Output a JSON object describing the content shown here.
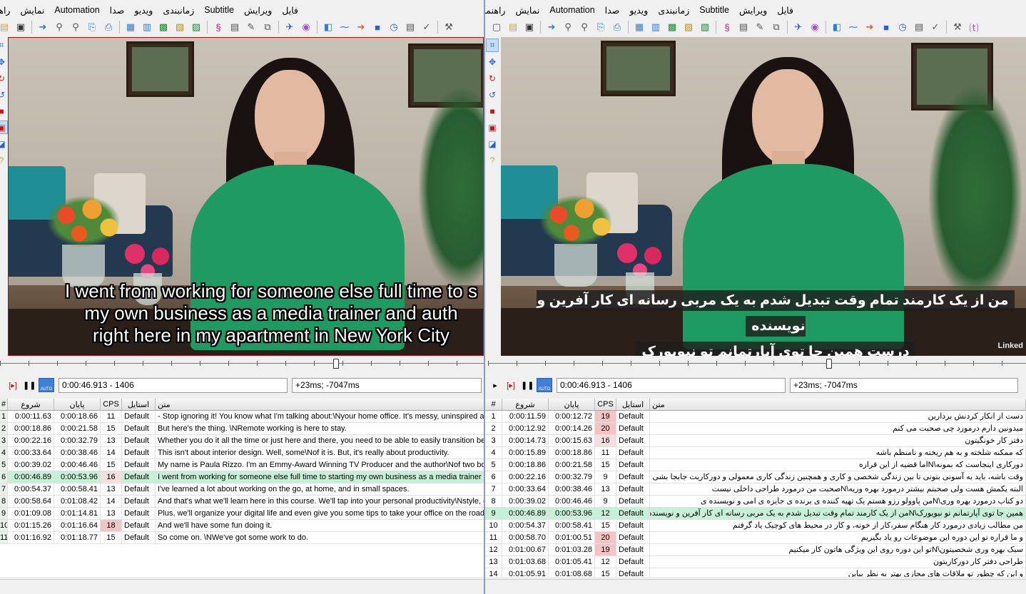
{
  "left": {
    "menu": [
      "فایل",
      "ویرایش",
      "Subtitle",
      "زمانبندی",
      "ویدیو",
      "صدا",
      "Automation",
      "نمایش",
      "راهنما"
    ],
    "subtitle_lines": [
      "I went from working for someone else full time to s",
      "my own business as a media trainer and auth",
      "right here in my apartment in New York City"
    ],
    "time_position": "0:00:46.913 - 1406",
    "offset": "+23ms; -7047ms",
    "columns": {
      "num": "#",
      "start": "شروع",
      "end": "پایان",
      "cps": "CPS",
      "style": "استایل",
      "text": "متن"
    },
    "rows": [
      {
        "n": "1",
        "start": "0:00:11.63",
        "end": "0:00:18.66",
        "cps": "11",
        "style": "Default",
        "text": "- Stop ignoring it! You know what I'm talking about:\\Nyour home office. It's messy, uninspired ar"
      },
      {
        "n": "2",
        "start": "0:00:18.86",
        "end": "0:00:21.58",
        "cps": "15",
        "style": "Default",
        "text": "But here's the thing. \\NRemote working is here to stay."
      },
      {
        "n": "3",
        "start": "0:00:22.16",
        "end": "0:00:32.79",
        "cps": "13",
        "style": "Default",
        "text": "Whether you do it all the time or just here and there, you need to be able to easily transition be"
      },
      {
        "n": "4",
        "start": "0:00:33.64",
        "end": "0:00:38.46",
        "cps": "14",
        "style": "Default",
        "text": "This isn't about interior design. Well, some\\Nof it is. But, it's really about productivity."
      },
      {
        "n": "5",
        "start": "0:00:39.02",
        "end": "0:00:46.46",
        "cps": "15",
        "style": "Default",
        "text": "My name is Paula Rizzo. I'm an Emmy-Award Winning TV Producer and the author\\Nof two books"
      },
      {
        "n": "6",
        "start": "0:00:46.89",
        "end": "0:00:53.96",
        "cps": "16",
        "style": "Default",
        "text": "I went from working for someone else full time to starting my own business as a media trainer ar",
        "selected": true
      },
      {
        "n": "7",
        "start": "0:00:54.37",
        "end": "0:00:58.41",
        "cps": "13",
        "style": "Default",
        "text": "I've learned a lot about working on the go, at home, and in small spaces."
      },
      {
        "n": "8",
        "start": "0:00:58.64",
        "end": "0:01:08.42",
        "cps": "14",
        "style": "Default",
        "text": "And that's what we'll learn here in this course. We'll tap into your personal productivity\\Nstyle, c"
      },
      {
        "n": "9",
        "start": "0:01:09.08",
        "end": "0:01:14.81",
        "cps": "13",
        "style": "Default",
        "text": "Plus, we'll organize your digital life and even give you some tips to take your office on the road."
      },
      {
        "n": "10",
        "start": "0:01:15.26",
        "end": "0:01:16.64",
        "cps": "18",
        "style": "Default",
        "text": "And we'll have some fun doing it."
      },
      {
        "n": "11",
        "start": "0:01:16.92",
        "end": "0:01:18.77",
        "cps": "15",
        "style": "Default",
        "text": "So come on. \\NWe've got some work to do."
      }
    ]
  },
  "right": {
    "menu": [
      "فایل",
      "ویرایش",
      "Subtitle",
      "زمانبندی",
      "ویدیو",
      "صدا",
      "Automation",
      "نمایش",
      "راهنما"
    ],
    "subtitle_lines": [
      "من از یک کارمند تمام وقت تبدیل شدم به یک مربی رسانه ای کار آفرین و نویسنده",
      "درست همین جا توی آپارتمانم تو نیویورک"
    ],
    "watermark": "Linked",
    "time_position": "0:00:46.913 - 1406",
    "offset": "+23ms; -7047ms",
    "columns": {
      "num": "#",
      "start": "شروع",
      "end": "پایان",
      "cps": "CPS",
      "style": "استایل",
      "text": "متن"
    },
    "rows": [
      {
        "n": "1",
        "start": "0:00:11.59",
        "end": "0:00:12.72",
        "cps": "19",
        "style": "Default",
        "text": "دست از انکار کردنش بردارین"
      },
      {
        "n": "2",
        "start": "0:00:12.92",
        "end": "0:00:14.26",
        "cps": "20",
        "style": "Default",
        "text": "میدونین دارم درمورد چی صحبت می کنم"
      },
      {
        "n": "3",
        "start": "0:00:14.73",
        "end": "0:00:15.63",
        "cps": "16",
        "style": "Default",
        "text": "دفتر کار خونگیتون"
      },
      {
        "n": "4",
        "start": "0:00:15.89",
        "end": "0:00:18.86",
        "cps": "11",
        "style": "Default",
        "text": "که ممکنه شلخته و به هم ریخته و نامنظم باشه"
      },
      {
        "n": "5",
        "start": "0:00:18.86",
        "end": "0:00:21.58",
        "cps": "15",
        "style": "Default",
        "text": "دورکاری اینجاست که بمونه\\Nاما قضیه از این قراره"
      },
      {
        "n": "6",
        "start": "0:00:22.16",
        "end": "0:00:32.79",
        "cps": "9",
        "style": "Default",
        "text": "وقت باشه، باید به آسونی بتونی تا بین زندگی شخصی و کاری و همچنین زندگی کاری معمولی و دورکاریت جابجا بشی"
      },
      {
        "n": "7",
        "start": "0:00:33.64",
        "end": "0:00:38.46",
        "cps": "13",
        "style": "Default",
        "text": "البته یکمش هست ولی صحبتم بیشتر درمورد بهره وریه\\Nصحبت من درمورد طراحی داخلی نیست"
      },
      {
        "n": "8",
        "start": "0:00:39.02",
        "end": "0:00:46.46",
        "cps": "9",
        "style": "Default",
        "text": "دو کتاب درمورد بهره وری\\Nمن پاوولو رزو هستم یک تهیه کننده ی برنده ی جایزه ی امی و نویسنده ی"
      },
      {
        "n": "9",
        "start": "0:00:46.89",
        "end": "0:00:53.96",
        "cps": "12",
        "style": "Default",
        "text": "همین جا توی آپارتمانم تو نیویورک\\Nمن از یک کارمند تمام وقت تبدیل شدم به یک مربی رسانه ای کار آفرین و نویسنده",
        "selected": true
      },
      {
        "n": "10",
        "start": "0:00:54.37",
        "end": "0:00:58.41",
        "cps": "15",
        "style": "Default",
        "text": "من مطالب زیادی درمورد کار هنگام سفر،کار از خونه، و کار در محیط های کوچیک یاد گرفتم"
      },
      {
        "n": "11",
        "start": "0:00:58.70",
        "end": "0:01:00.51",
        "cps": "20",
        "style": "Default",
        "text": "و ما قراره تو این دوره این موضوعات رو یاد بگیریم"
      },
      {
        "n": "12",
        "start": "0:01:00.67",
        "end": "0:01:03.28",
        "cps": "19",
        "style": "Default",
        "text": "سبک بهره وری شخصیتون\\Nتو این دوره روی این ویژگی هاتون کار میکنیم"
      },
      {
        "n": "13",
        "start": "0:01:03.68",
        "end": "0:01:05.41",
        "cps": "12",
        "style": "Default",
        "text": "طراحی دفتر کار دورکاریتون"
      },
      {
        "n": "14",
        "start": "0:01:05.91",
        "end": "0:01:08.68",
        "cps": "15",
        "style": "Default",
        "text": "و این که چطور تو ملاقات های مجازی بهتر به نظر بیاین"
      }
    ]
  },
  "colors": {
    "selected_row": "#c8f0d6",
    "cps_high": "#f2c4c4",
    "auto_button": "#3f7fd6",
    "frame_border": "#b01010"
  }
}
